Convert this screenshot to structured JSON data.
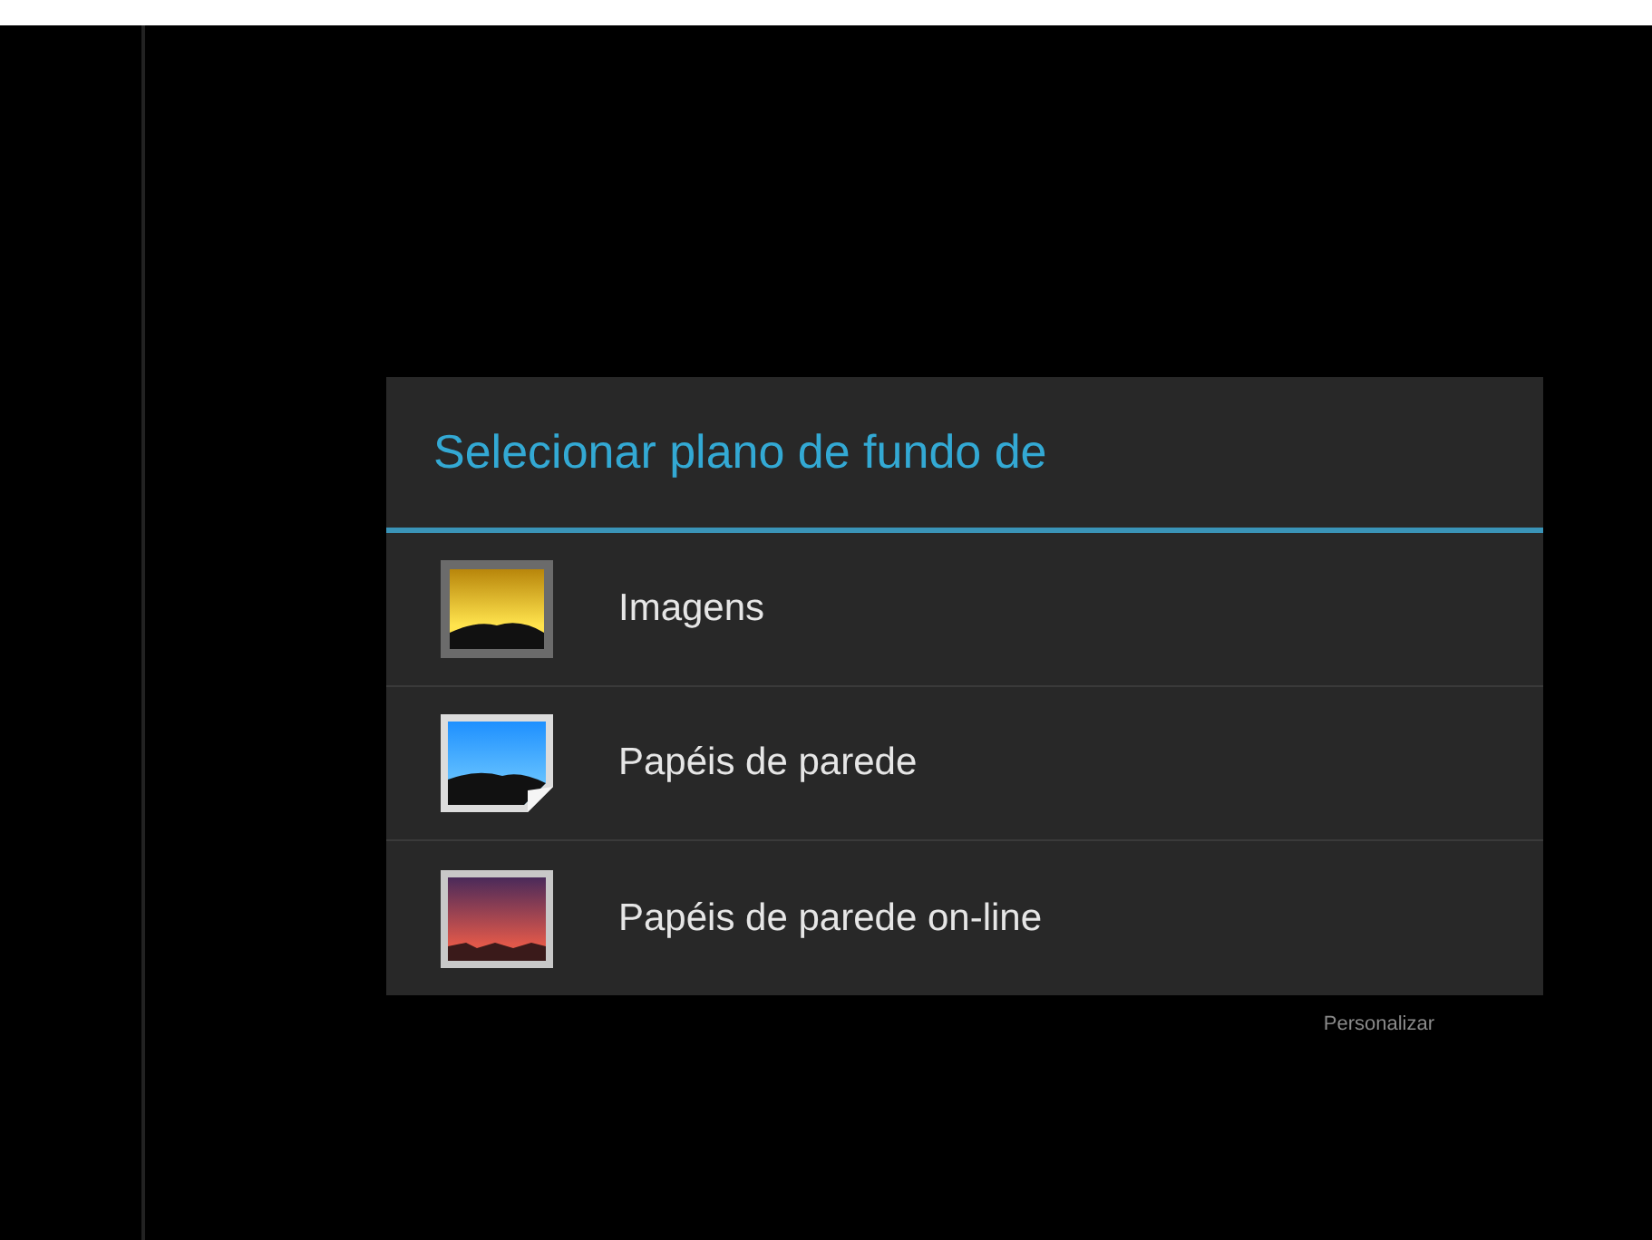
{
  "dialog": {
    "title": "Selecionar plano de fundo de",
    "items": [
      {
        "label": "Imagens",
        "kind": "gallery"
      },
      {
        "label": "Papéis de parede",
        "kind": "wallpaper"
      },
      {
        "label": "Papéis de parede on-line",
        "kind": "online"
      }
    ]
  },
  "footer_label": "Personalizar"
}
